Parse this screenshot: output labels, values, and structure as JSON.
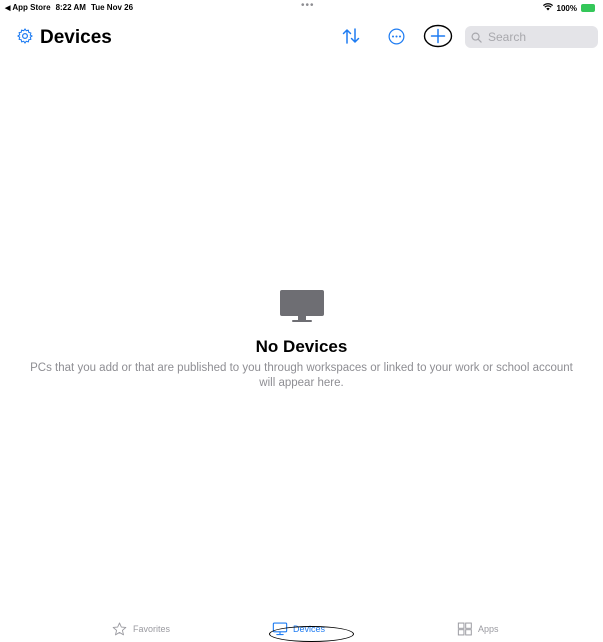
{
  "status_bar": {
    "back_app": "App Store",
    "time": "8:22 AM",
    "date": "Tue Nov 26",
    "center_dots": "•••",
    "battery": "100%"
  },
  "nav": {
    "title": "Devices",
    "search": {
      "placeholder": "Search",
      "value": ""
    },
    "icons": [
      "gear-icon",
      "sort-icon",
      "more-icon",
      "add-icon",
      "search-icon"
    ],
    "accent_color": "#1e7cf2"
  },
  "empty_state": {
    "icon": "monitor-icon",
    "title": "No Devices",
    "description": "PCs that you add or that are published to you through workspaces or linked to your work or school account will appear here."
  },
  "tab_bar": {
    "tabs": [
      {
        "label": "Favorites",
        "icon": "star-icon",
        "selected": false
      },
      {
        "label": "Devices",
        "icon": "monitor-icon",
        "selected": true
      },
      {
        "label": "Apps",
        "icon": "apps-grid-icon",
        "selected": false
      }
    ]
  }
}
